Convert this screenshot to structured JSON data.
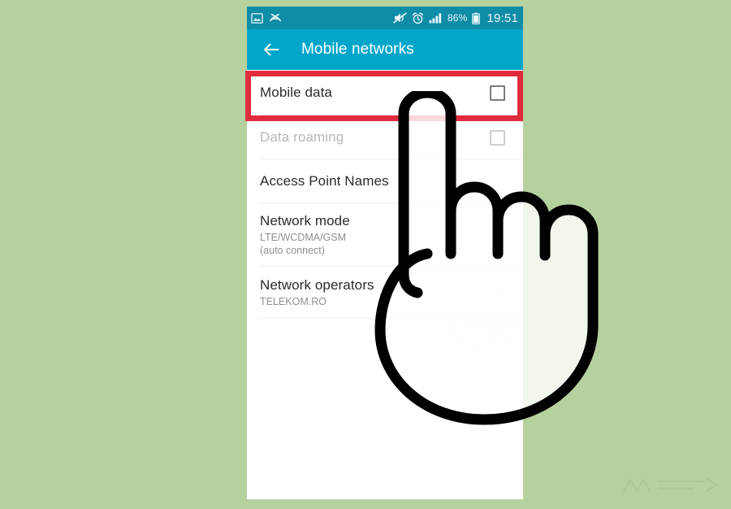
{
  "background": {
    "color": "#b5d19e"
  },
  "phone": {
    "status_bar": {
      "background": "#0f8ca6",
      "left_icons": [
        {
          "name": "screenshot-icon",
          "label": "screenshot"
        },
        {
          "name": "missed-call-icon",
          "label": "missed call"
        }
      ],
      "right_icons": [
        {
          "name": "mute-icon",
          "label": "sound muted"
        },
        {
          "name": "alarm-clock-icon",
          "label": "alarm set"
        },
        {
          "name": "signal-bars-icon",
          "label": "signal strength"
        },
        {
          "name": "battery-icon",
          "label": "battery"
        }
      ],
      "battery_percent": "86%",
      "clock": "19:51"
    },
    "app_bar": {
      "background": "#00a6c9",
      "back_icon": "back-arrow-icon",
      "title": "Mobile networks"
    },
    "list": {
      "rows": [
        {
          "id": "mobile-data",
          "title": "Mobile data",
          "subtitle": "",
          "control": "checkbox",
          "checked": false,
          "disabled": false,
          "highlighted": true
        },
        {
          "id": "data-roaming",
          "title": "Data roaming",
          "subtitle": "",
          "control": "checkbox",
          "checked": false,
          "disabled": true,
          "highlighted": false
        },
        {
          "id": "access-point-names",
          "title": "Access Point Names",
          "subtitle": "",
          "control": "none",
          "checked": false,
          "disabled": false,
          "highlighted": false
        },
        {
          "id": "network-mode",
          "title": "Network mode",
          "subtitle": "LTE/WCDMA/GSM\n(auto connect)",
          "control": "none",
          "checked": false,
          "disabled": false,
          "highlighted": false
        },
        {
          "id": "network-operators",
          "title": "Network operators",
          "subtitle": "TELEKOM.RO",
          "control": "none",
          "checked": false,
          "disabled": false,
          "highlighted": false
        }
      ]
    }
  },
  "annotation": {
    "highlight_color": "#e02b3c",
    "highlight_target": "Mobile data",
    "pointer": "pointing-hand-cursor"
  }
}
